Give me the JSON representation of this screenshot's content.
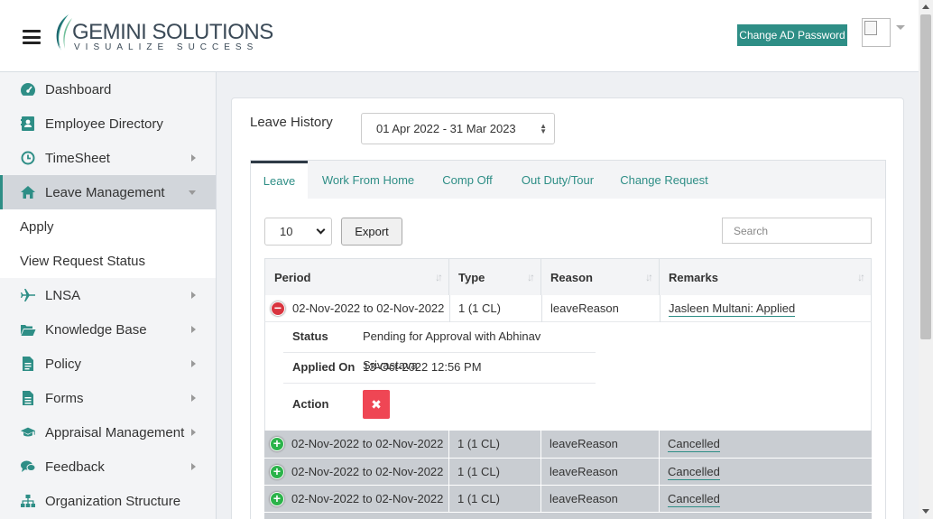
{
  "header": {
    "logo_name": "GEMINI SOLUTIONS",
    "logo_tagline": "VISUALIZE SUCCESS",
    "change_ad_password": "Change AD Password",
    "brand_color": "#2e8e86"
  },
  "sidebar": {
    "items": [
      {
        "label": "Dashboard",
        "icon": "dashboard-icon"
      },
      {
        "label": "Employee Directory",
        "icon": "address-book-icon"
      },
      {
        "label": "TimeSheet",
        "icon": "clock-icon"
      },
      {
        "label": "Leave Management",
        "icon": "home-icon"
      },
      {
        "label": "LNSA",
        "icon": "plane-icon"
      },
      {
        "label": "Knowledge Base",
        "icon": "folder-open-icon"
      },
      {
        "label": "Policy",
        "icon": "document-icon"
      },
      {
        "label": "Forms",
        "icon": "file-icon"
      },
      {
        "label": "Appraisal Management",
        "icon": "graduation-cap-icon"
      },
      {
        "label": "Feedback",
        "icon": "comments-icon"
      },
      {
        "label": "Organization Structure",
        "icon": "sitemap-icon"
      }
    ],
    "sub_items": [
      {
        "label": "Apply"
      },
      {
        "label": "View Request Status"
      }
    ]
  },
  "main": {
    "leave_history_label": "Leave History",
    "period_value": "01 Apr 2022 - 31 Mar 2023",
    "tabs": [
      {
        "label": "Leave"
      },
      {
        "label": "Work From Home"
      },
      {
        "label": "Comp Off"
      },
      {
        "label": "Out Duty/Tour"
      },
      {
        "label": "Change Request"
      }
    ],
    "page_length": "10",
    "export_label": "Export",
    "search_placeholder": "Search",
    "table": {
      "columns": [
        "Period",
        "Type",
        "Reason",
        "Remarks"
      ],
      "rows": [
        {
          "period": "02-Nov-2022 to 02-Nov-2022",
          "type": "1 (1 CL)",
          "reason": "leaveReason",
          "remarks": "Jasleen Multani: Applied"
        },
        {
          "period": "02-Nov-2022 to 02-Nov-2022",
          "type": "1 (1 CL)",
          "reason": "leaveReason",
          "remarks": "Cancelled"
        },
        {
          "period": "02-Nov-2022 to 02-Nov-2022",
          "type": "1 (1 CL)",
          "reason": "leaveReason",
          "remarks": "Cancelled"
        },
        {
          "period": "02-Nov-2022 to 02-Nov-2022",
          "type": "1 (1 CL)",
          "reason": "leaveReason",
          "remarks": "Cancelled"
        }
      ],
      "detail": {
        "status_label": "Status",
        "status_value": "Pending for Approval with Abhinav Srivastava",
        "applied_on_label": "Applied On",
        "applied_on_value": "13-Oct-2022 12:56 PM",
        "action_label": "Action"
      }
    }
  }
}
